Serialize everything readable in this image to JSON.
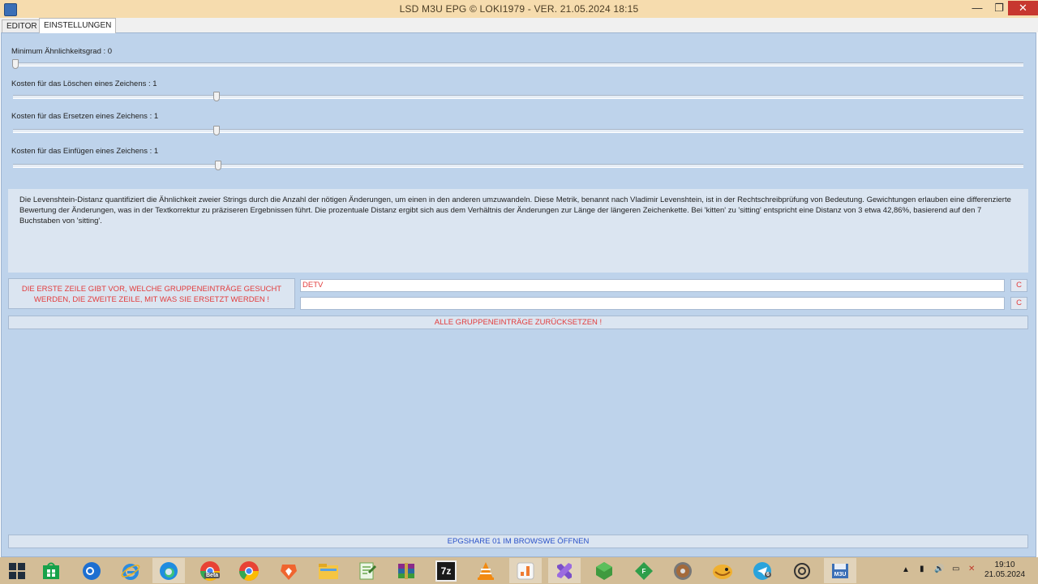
{
  "window": {
    "title": "LSD M3U EPG © LOKI1979 - VER. 21.05.2024 18:15",
    "minimize": "—",
    "maximize": "❐",
    "close": "✕"
  },
  "tabs": [
    {
      "label": "EDITOR",
      "active": false
    },
    {
      "label": "EINSTELLUNGEN",
      "active": true
    }
  ],
  "sliders": [
    {
      "label": "Minimum Ähnlichkeitsgrad : 0",
      "value": 0
    },
    {
      "label": "Kosten für das Löschen eines Zeichens : 1",
      "value": 1
    },
    {
      "label": "Kosten für das Ersetzen eines Zeichens : 1",
      "value": 1
    },
    {
      "label": "Kosten für das Einfügen eines Zeichens : 1",
      "value": 1
    }
  ],
  "info_text": "Die Levenshtein-Distanz quantifiziert die Ähnlichkeit zweier Strings durch die Anzahl der nötigen Änderungen, um einen in den anderen umzuwandeln. Diese Metrik, benannt nach Vladimir Levenshtein, ist in der Rechtschreibprüfung von Bedeutung. Gewichtungen erlauben eine differenzierte Bewertung der Änderungen, was in der Textkorrektur zu präziseren Ergebnissen führt. Die prozentuale Distanz ergibt sich aus dem Verhältnis der Änderungen zur Länge der längeren Zeichenkette. Bei 'kitten' zu 'sitting' entspricht eine Distanz von 3 etwa 42,86%, basierend auf den 7 Buchstaben von 'sitting'.",
  "group_replace": {
    "hint": "DIE ERSTE ZEILE GIBT VOR, WELCHE GRUPPENEINTRÄGE GESUCHT WERDEN, DIE ZWEITE ZEILE, MIT WAS SIE ERSETZT WERDEN !",
    "search_value": "DETV",
    "replace_value": "",
    "clear_label": "C"
  },
  "reset_all_label": "ALLE GRUPPENEINTRÄGE ZURÜCKSETZEN !",
  "open_browser_label": "EPGSHARE 01 IM BROWSWE ÖFFNEN",
  "taskbar": {
    "time": "19:10",
    "date": "21.05.2024",
    "apps": [
      "start",
      "store",
      "outlook",
      "internet-explorer",
      "edge",
      "chrome-beta",
      "chrome",
      "brave",
      "file-explorer",
      "notepad",
      "winrar",
      "7zip",
      "vlc",
      "sublime",
      "visual-studio",
      "app-green-cube",
      "app-green-diamond",
      "dvd",
      "duck-app",
      "telegram",
      "chatgpt",
      "m3u-app"
    ],
    "telegram_badge": "6",
    "chrome_beta_badge": "Beta",
    "m3u_label": "M3U",
    "sevenzip_label": "7z",
    "f_label": "F"
  }
}
